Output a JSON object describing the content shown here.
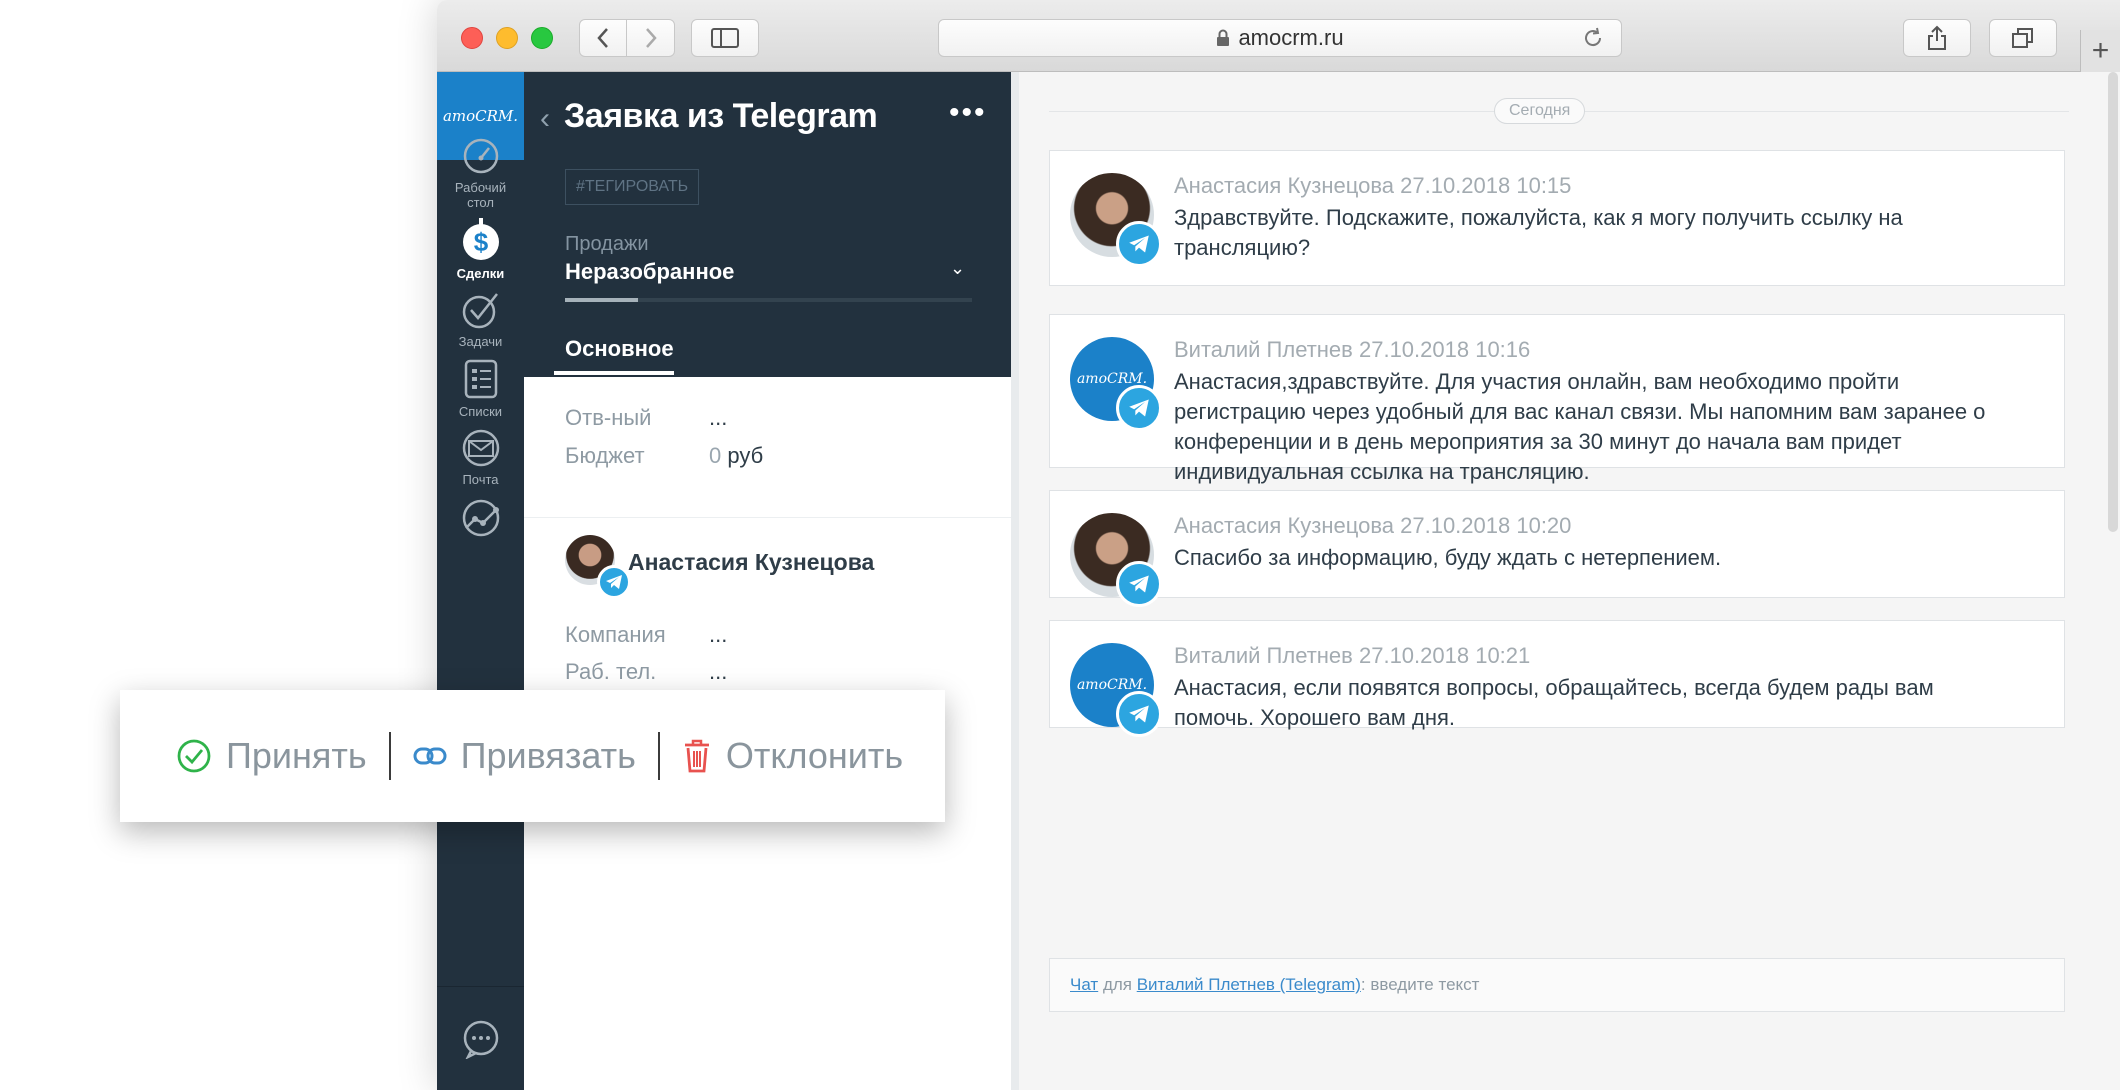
{
  "browser": {
    "url": "amocrm.ru"
  },
  "nav": {
    "logo": "amoCRM.",
    "items": [
      {
        "label_line1": "Рабочий",
        "label_line2": "стол"
      },
      {
        "label_line1": "Сделки",
        "label_line2": ""
      },
      {
        "label_line1": "Задачи",
        "label_line2": ""
      },
      {
        "label_line1": "Списки",
        "label_line2": ""
      },
      {
        "label_line1": "Почта",
        "label_line2": ""
      }
    ]
  },
  "lead": {
    "title": "Заявка из Telegram",
    "more": "•••",
    "tag_button": "#ТЕГИРОВАТЬ",
    "pipeline_label": "Продажи",
    "pipeline_stage": "Неразобранное",
    "pipeline_progress": 0.18,
    "tab_main": "Основное",
    "fields": {
      "responsible_label": "Отв-ный",
      "responsible_value": "...",
      "budget_label": "Бюджет",
      "budget_value": "0",
      "budget_currency": "руб"
    },
    "contact": {
      "name": "Анастасия Кузнецова",
      "company_label": "Компания",
      "company_value": "...",
      "phone_label": "Раб. тел.",
      "phone_value": "..."
    }
  },
  "actions": {
    "accept": "Принять",
    "bind": "Привязать",
    "decline": "Отклонить"
  },
  "chat": {
    "date_separator": "Сегодня",
    "messages": [
      {
        "author": "Анастасия Кузнецова",
        "time": "27.10.2018 10:15",
        "text": "Здравствуйте. Подскажите, пожалуйста, как я могу получить ссылку на трансляцию?"
      },
      {
        "author": "Виталий Плетнев",
        "time": "27.10.2018 10:16",
        "text": "Анастасия,здравствуйте. Для участия онлайн, вам необходимо пройти регистрацию через удобный для вас канал связи. Мы напомним вам заранее о конференции и в день мероприятия за 30 минут до начала вам придет индивидуальная ссылка на трансляцию."
      },
      {
        "author": "Анастасия Кузнецова",
        "time": "27.10.2018 10:20",
        "text": "Спасибо за информацию, буду ждать с нетерпением."
      },
      {
        "author": "Виталий Плетнев",
        "time": "27.10.2018 10:21",
        "text": "Анастасия, если появятся вопросы, обращайтесь, всегда будем рады вам помочь. Хорошего вам дня."
      }
    ],
    "input": {
      "link_chat": "Чат",
      "for": "для",
      "link_contact": "Виталий Плетнев (Telegram)",
      "hint": ": введите текст"
    }
  },
  "colors": {
    "accept": "#2fb34a",
    "bind": "#3a8acb",
    "decline": "#e8524f",
    "telegram": "#2ca5e0",
    "brand": "#1b81c9"
  }
}
